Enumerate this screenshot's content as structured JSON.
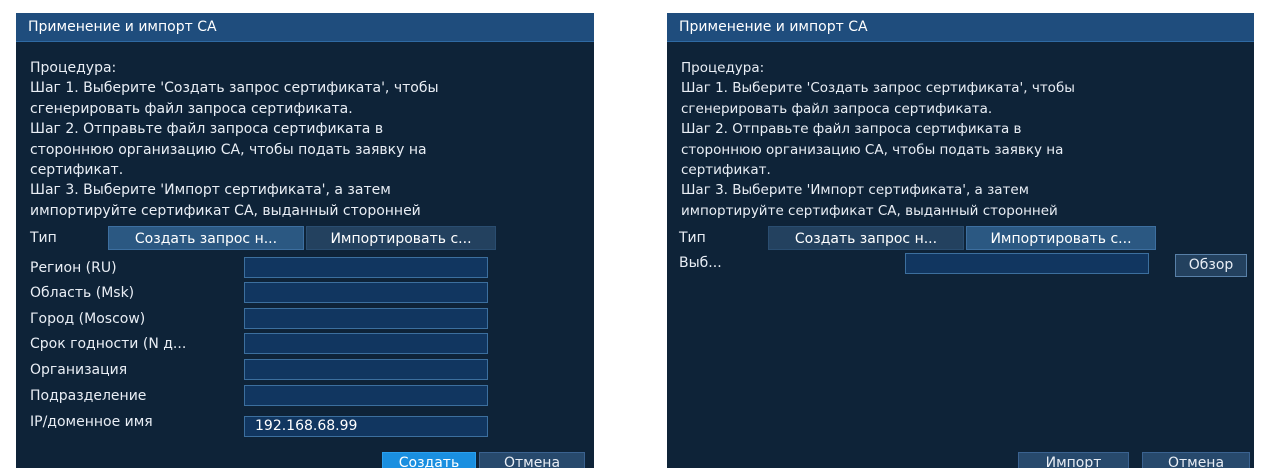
{
  "left_dialog": {
    "title": "Применение и импорт СА",
    "procedure": [
      "Процедура:",
      " Шаг 1. Выберите 'Создать запрос сертификата', чтобы",
      "сгенерировать файл запроса сертификата.",
      " Шаг 2. Отправьте файл запроса сертификата в",
      "стороннюю организацию CA, чтобы подать заявку на",
      "сертификат.",
      " Шаг 3. Выберите 'Импорт сертификата', а затем",
      "импортируйте сертификат СА, выданный сторонней"
    ],
    "type_label": "Тип",
    "type_options": [
      "Создать запрос н...",
      "Импортировать с..."
    ],
    "selected_type": "Создать запрос н...",
    "fields": [
      {
        "label": "Регион (RU)",
        "value": ""
      },
      {
        "label": "Область (Msk)",
        "value": ""
      },
      {
        "label": "Город (Moscow)",
        "value": ""
      },
      {
        "label": "Срок годности (N д...",
        "value": ""
      },
      {
        "label": "Организация",
        "value": ""
      },
      {
        "label": "Подразделение",
        "value": ""
      },
      {
        "label": "IP/доменное имя",
        "value": "192.168.68.99"
      }
    ],
    "create_label": "Создать",
    "cancel_label": "Отмена"
  },
  "right_dialog": {
    "title": "Применение и импорт СА",
    "procedure": [
      "Процедура:",
      " Шаг 1. Выберите 'Создать запрос сертификата', чтобы",
      "сгенерировать файл запроса сертификата.",
      " Шаг 2. Отправьте файл запроса сертификата в",
      "стороннюю организацию CA, чтобы подать заявку на",
      "сертификат.",
      " Шаг 3. Выберите 'Импорт сертификата', а затем",
      "импортируйте сертификат СА, выданный сторонней"
    ],
    "type_label": "Тип",
    "type_options": [
      "Создать запрос н...",
      "Импортировать с..."
    ],
    "selected_type": "Импортировать с...",
    "select_label": "Выб...",
    "file_value": "",
    "browse_label": "Обзор",
    "import_label": "Импорт",
    "cancel_label": "Отмена"
  },
  "colors": {
    "dialog_bg": "#0e2338",
    "title_bar": "#1f4d7d",
    "input_bg": "#113660",
    "input_border": "#3c6f9e",
    "primary_button": "#1a8fe0",
    "text": "#e9eef5"
  }
}
